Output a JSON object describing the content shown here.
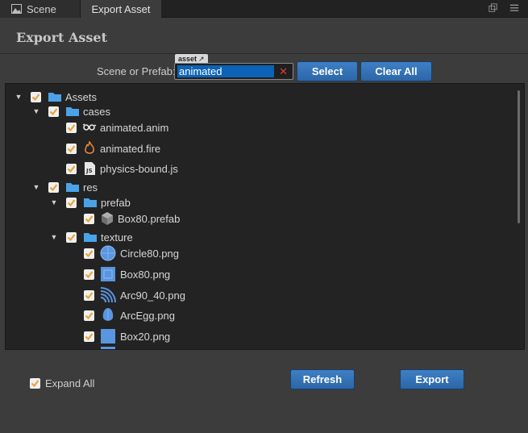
{
  "tabs": [
    {
      "label": "Scene",
      "active": false
    },
    {
      "label": "Export Asset",
      "active": true
    }
  ],
  "panel": {
    "title": "Export Asset"
  },
  "scene_or_prefab": {
    "label": "Scene or Prefab:",
    "tag": "asset",
    "value": "animated",
    "select_label": "Select",
    "clear_all_label": "Clear All"
  },
  "tree": {
    "assets_label": "Assets",
    "cases_label": "cases",
    "animated_anim": "animated.anim",
    "animated_fire": "animated.fire",
    "physics_bound": "physics-bound.js",
    "res_label": "res",
    "prefab_label": "prefab",
    "box80_prefab": "Box80.prefab",
    "texture_label": "texture",
    "circle80": "Circle80.png",
    "box80_png": "Box80.png",
    "arc90_40": "Arc90_40.png",
    "arc_egg": "ArcEgg.png",
    "box20": "Box20.png"
  },
  "footer": {
    "expand_all_label": "Expand All",
    "expand_all_checked": true,
    "refresh_label": "Refresh",
    "export_label": "Export"
  },
  "colors": {
    "accent_button": "#2f6db0",
    "checkbox_check": "#e8a33d",
    "folder": "#4aa3e8",
    "selection": "#0d62b6"
  }
}
